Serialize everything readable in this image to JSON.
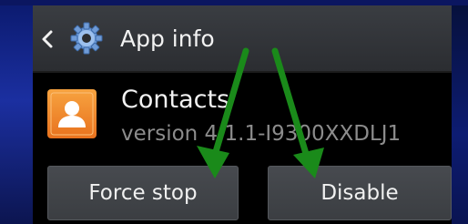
{
  "header": {
    "title": "App info",
    "back_icon": "chevron-left-icon",
    "settings_icon": "gear-icon"
  },
  "app": {
    "name": "Contacts",
    "version": "version 4.1.1-I9300XXDLJ1",
    "icon": "contact-person-icon"
  },
  "buttons": {
    "force_stop": "Force stop",
    "disable": "Disable"
  },
  "annotations": {
    "arrow_color": "#1a8a1a",
    "arrow_icons": [
      "arrow-to-force-stop",
      "arrow-to-disable"
    ]
  },
  "colors": {
    "header_bg": "#34373b",
    "screen_bg": "#000000",
    "button_bg": "#43464a",
    "text_primary": "#f2f2f2",
    "text_secondary": "#8c8c8c",
    "app_icon_orange": "#ee8a2a"
  }
}
